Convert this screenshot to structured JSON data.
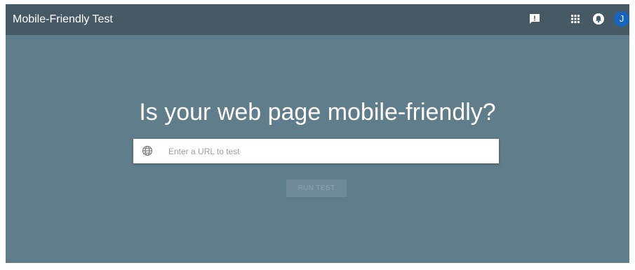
{
  "header": {
    "title": "Mobile-Friendly Test",
    "icons": [
      "feedback-icon",
      "apps-icon",
      "notifications-icon"
    ],
    "avatar_initial": "J",
    "avatar_color": "#1565c0"
  },
  "main": {
    "headline": "Is your web page mobile-friendly?",
    "url_input": {
      "placeholder": "Enter a URL to test",
      "value": "",
      "icon": "globe-icon"
    },
    "run_button_label": "RUN TEST",
    "run_button_enabled": false
  },
  "colors": {
    "background": "#607d8b",
    "header_background": "#455a64",
    "text": "#ffffff"
  }
}
